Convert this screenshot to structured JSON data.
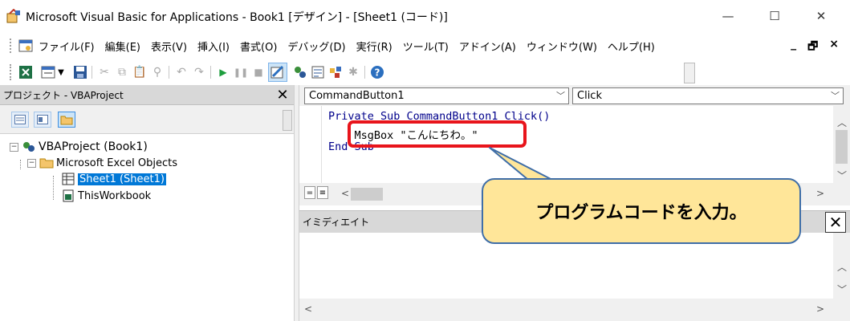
{
  "window": {
    "title": "Microsoft Visual Basic for Applications - Book1 [デザイン] - [Sheet1 (コード)]",
    "minimize": "—",
    "maximize": "☐",
    "close": "✕"
  },
  "menu": {
    "items": [
      "ファイル(F)",
      "編集(E)",
      "表示(V)",
      "挿入(I)",
      "書式(O)",
      "デバッグ(D)",
      "実行(R)",
      "ツール(T)",
      "アドイン(A)",
      "ウィンドウ(W)",
      "ヘルプ(H)"
    ],
    "mdi_minimize": "_",
    "mdi_restore": "🗗",
    "mdi_close": "×"
  },
  "toolbar": {
    "icons": [
      "excel-view",
      "insert-userform",
      "dropdown",
      "save",
      "cut",
      "copy",
      "paste",
      "find",
      "undo",
      "redo",
      "run",
      "break",
      "reset",
      "design-mode",
      "project-explorer",
      "properties-window",
      "object-browser",
      "toolbox",
      "help"
    ]
  },
  "project": {
    "title": "プロジェクト - VBAProject",
    "close": "✕",
    "tree": {
      "root": "VBAProject (Book1)",
      "folder": "Microsoft Excel Objects",
      "sheet1": "Sheet1 (Sheet1)",
      "workbook": "ThisWorkbook"
    }
  },
  "code": {
    "object_combo": "CommandButton1",
    "procedure_combo": "Click",
    "lines": [
      "Private Sub CommandButton1_Click()",
      "    MsgBox \"こんにちわ。\"",
      "End Sub"
    ]
  },
  "callout": {
    "text": "プログラムコードを入力。",
    "fill": "#ffe699",
    "border": "#3f6ea8"
  },
  "highlight_color": "#e8141b",
  "immediate": {
    "title": "イミディエイト",
    "close": "✕"
  }
}
